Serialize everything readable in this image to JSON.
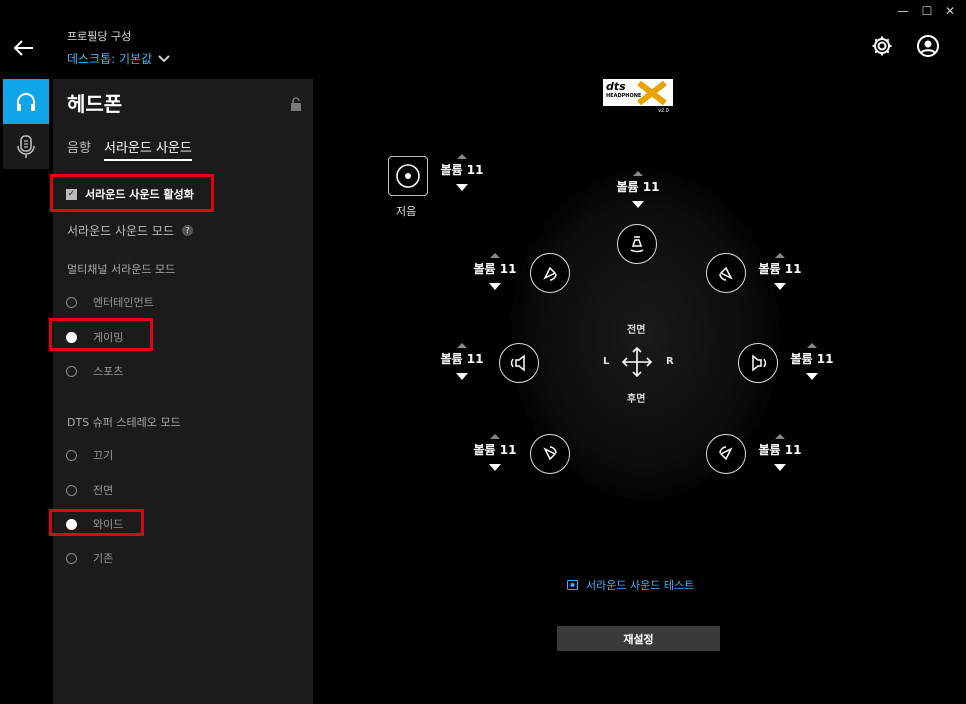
{
  "window": {
    "minimize": "—",
    "maximize": "☐",
    "close": "✕"
  },
  "header": {
    "title": "프로필당 구성",
    "profile": "데스크톱: 기본값"
  },
  "panel": {
    "title": "헤드폰",
    "tabs": [
      "음향",
      "서라운드 사운드"
    ],
    "enable_label": "서라운드 사운드 활성화",
    "mode_label": "서라운드 사운드 모드",
    "help": "?",
    "multichannel_title": "멀티채널 서라운드 모드",
    "multichannel_options": [
      "엔터테인먼트",
      "게이밍",
      "스포츠"
    ],
    "multichannel_selected": "게이밍",
    "dts_title": "DTS 슈퍼 스테레오 모드",
    "dts_options": [
      "끄기",
      "전면",
      "와이드",
      "기존"
    ],
    "dts_selected": "와이드"
  },
  "main": {
    "dts_logo": {
      "top": "dts",
      "middle": "HEADPHONE",
      "version": "v2.0"
    },
    "mute_label": "저음",
    "volume_label": "볼륨 11",
    "front": "전면",
    "rear": "후면",
    "left": "L",
    "right": "R",
    "test_link": "서라운드 사운드 테스트",
    "reset": "재설정"
  },
  "colors": {
    "accent": "#0ea5e9",
    "highlight": "#e3000f",
    "link": "#3cb4ff"
  }
}
